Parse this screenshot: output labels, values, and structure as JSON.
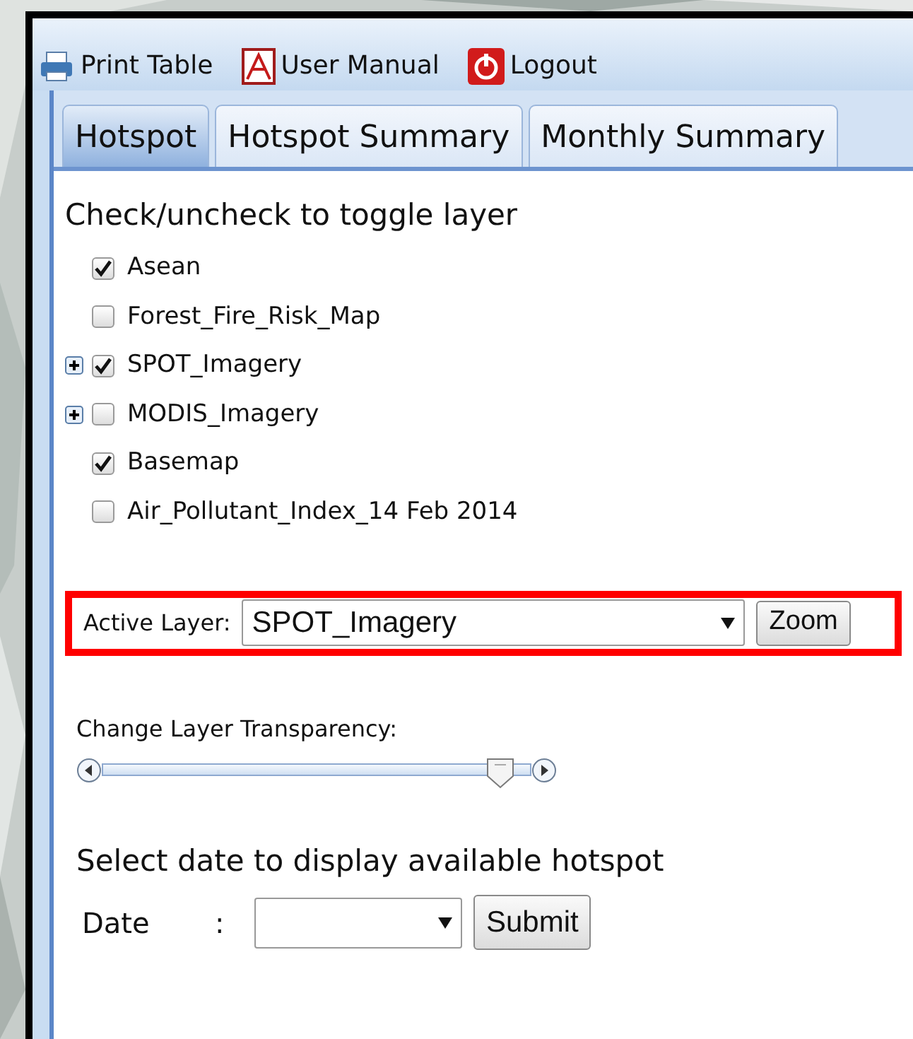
{
  "toolbar": [
    {
      "kind": "print",
      "label": "Print Table"
    },
    {
      "kind": "manual",
      "label": "User Manual"
    },
    {
      "kind": "logout",
      "label": "Logout"
    }
  ],
  "tabs": [
    {
      "label": "Hotspot",
      "selected": true
    },
    {
      "label": "Hotspot Summary",
      "selected": false
    },
    {
      "label": "Monthly Summary",
      "selected": false
    }
  ],
  "layers": {
    "heading": "Check/uncheck to toggle layer",
    "items": [
      {
        "label": "Asean",
        "checked": true,
        "expandable": false
      },
      {
        "label": "Forest_Fire_Risk_Map",
        "checked": false,
        "expandable": false
      },
      {
        "label": "SPOT_Imagery",
        "checked": true,
        "expandable": true
      },
      {
        "label": "MODIS_Imagery",
        "checked": false,
        "expandable": true
      },
      {
        "label": "Basemap",
        "checked": true,
        "expandable": false
      },
      {
        "label": "Air_Pollutant_Index_14 Feb 2014",
        "checked": false,
        "expandable": false
      }
    ]
  },
  "active_layer": {
    "label": "Active Layer:",
    "value": "SPOT_Imagery",
    "button": "Zoom",
    "highlighted": true
  },
  "transparency": {
    "label": "Change Layer Transparency:",
    "level": 0.93
  },
  "date_select": {
    "heading": "Select date to display available hotspot",
    "label": "Date",
    "separator": ":",
    "button": "Submit"
  }
}
